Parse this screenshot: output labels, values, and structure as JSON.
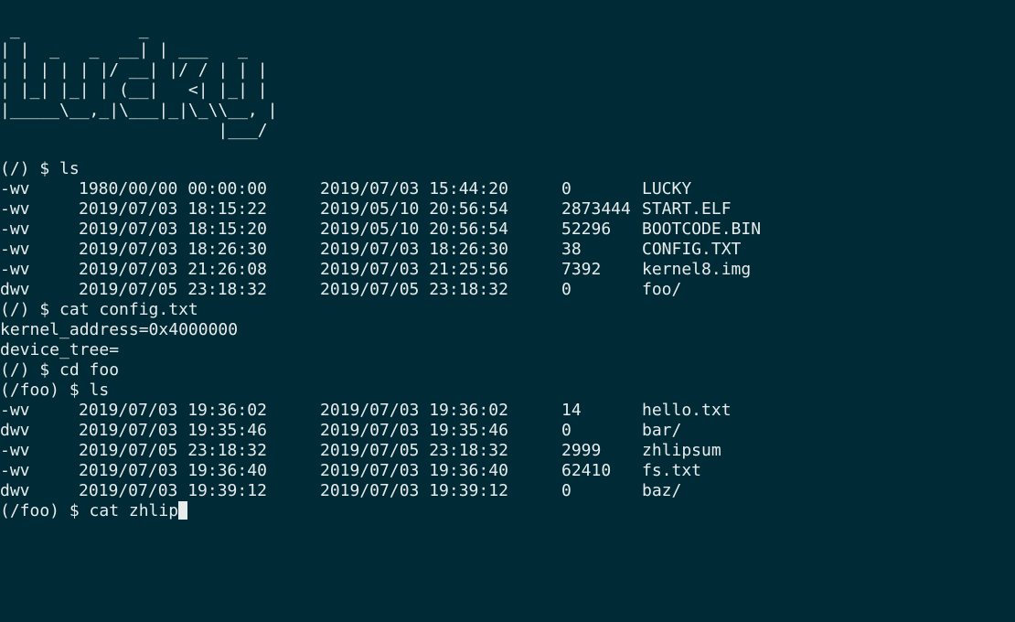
{
  "banner": " _            _\n| |  _   _  __| | ___   _\n| | | | | |/ __| |/ / | | |\n| |_| |_| | (__|   <| |_| |\n|_____\\__,_|\\___|_|\\_\\\\__, |\n                      |___/",
  "session": {
    "cmd1": "(/) $ ls",
    "root_listing": [
      {
        "perm": "-wv",
        "modified": "1980/00/00 00:00:00",
        "created": "2019/07/03 15:44:20",
        "size": "0",
        "name": "LUCKY"
      },
      {
        "perm": "-wv",
        "modified": "2019/07/03 18:15:22",
        "created": "2019/05/10 20:56:54",
        "size": "2873444",
        "name": "START.ELF"
      },
      {
        "perm": "-wv",
        "modified": "2019/07/03 18:15:20",
        "created": "2019/05/10 20:56:54",
        "size": "52296",
        "name": "BOOTCODE.BIN"
      },
      {
        "perm": "-wv",
        "modified": "2019/07/03 18:26:30",
        "created": "2019/07/03 18:26:30",
        "size": "38",
        "name": "CONFIG.TXT"
      },
      {
        "perm": "-wv",
        "modified": "2019/07/03 21:26:08",
        "created": "2019/07/03 21:25:56",
        "size": "7392",
        "name": "kernel8.img"
      },
      {
        "perm": "dwv",
        "modified": "2019/07/05 23:18:32",
        "created": "2019/07/05 23:18:32",
        "size": "0",
        "name": "foo/"
      }
    ],
    "cmd2": "(/) $ cat config.txt",
    "config_line1": "kernel_address=0x4000000",
    "config_line2": "device_tree=",
    "cmd3": "(/) $ cd foo",
    "cmd4": "(/foo) $ ls",
    "foo_listing": [
      {
        "perm": "-wv",
        "modified": "2019/07/03 19:36:02",
        "created": "2019/07/03 19:36:02",
        "size": "14",
        "name": "hello.txt"
      },
      {
        "perm": "dwv",
        "modified": "2019/07/03 19:35:46",
        "created": "2019/07/03 19:35:46",
        "size": "0",
        "name": "bar/"
      },
      {
        "perm": "-wv",
        "modified": "2019/07/05 23:18:32",
        "created": "2019/07/05 23:18:32",
        "size": "2999",
        "name": "zhlipsum"
      },
      {
        "perm": "-wv",
        "modified": "2019/07/03 19:36:40",
        "created": "2019/07/03 19:36:40",
        "size": "62410",
        "name": "fs.txt"
      },
      {
        "perm": "dwv",
        "modified": "2019/07/03 19:39:12",
        "created": "2019/07/03 19:39:12",
        "size": "0",
        "name": "baz/"
      }
    ],
    "current_input": "(/foo) $ cat zhlip"
  },
  "colors": {
    "background": "#002b36",
    "foreground": "#e8ecec"
  }
}
